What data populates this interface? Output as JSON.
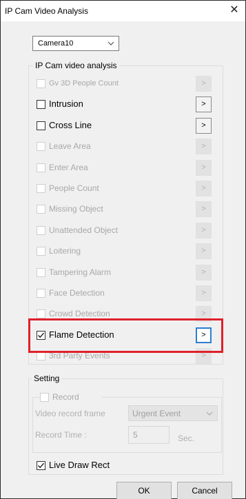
{
  "window": {
    "title": "IP Cam Video Analysis"
  },
  "camera_select": {
    "value": "Camera10"
  },
  "analysis_group": {
    "title": "IP Cam video analysis",
    "items": [
      {
        "label": "Gv 3D People Count",
        "enabled": false,
        "checked": false,
        "small": true
      },
      {
        "label": "Intrusion",
        "enabled": true,
        "checked": false
      },
      {
        "label": "Cross Line",
        "enabled": true,
        "checked": false
      },
      {
        "label": "Leave Area",
        "enabled": false,
        "checked": false
      },
      {
        "label": "Enter Area",
        "enabled": false,
        "checked": false
      },
      {
        "label": "People Count",
        "enabled": false,
        "checked": false
      },
      {
        "label": "Missing Object",
        "enabled": false,
        "checked": false
      },
      {
        "label": "Unattended Object",
        "enabled": false,
        "checked": false
      },
      {
        "label": "Loitering",
        "enabled": false,
        "checked": false
      },
      {
        "label": "Tampering Alarm",
        "enabled": false,
        "checked": false
      },
      {
        "label": "Face Detection",
        "enabled": false,
        "checked": false
      },
      {
        "label": "Crowd Detection",
        "enabled": false,
        "checked": false
      },
      {
        "label": "Flame Detection",
        "enabled": true,
        "checked": true
      },
      {
        "label": "3rd Party Events",
        "enabled": false,
        "checked": false
      }
    ],
    "arrow_label": ">"
  },
  "setting_group": {
    "title": "Setting",
    "record": {
      "label": "Record",
      "checked": false
    },
    "video_record_frame": {
      "label": "Video record frame",
      "value": "Urgent Event"
    },
    "record_time": {
      "label": "Record Time :",
      "value": "5",
      "unit": "Sec."
    },
    "live_draw_rect": {
      "label": "Live Draw Rect",
      "checked": true
    }
  },
  "buttons": {
    "ok": "OK",
    "cancel": "Cancel"
  },
  "colors": {
    "highlight": "#e0202a",
    "focus": "#2a7fd6"
  }
}
